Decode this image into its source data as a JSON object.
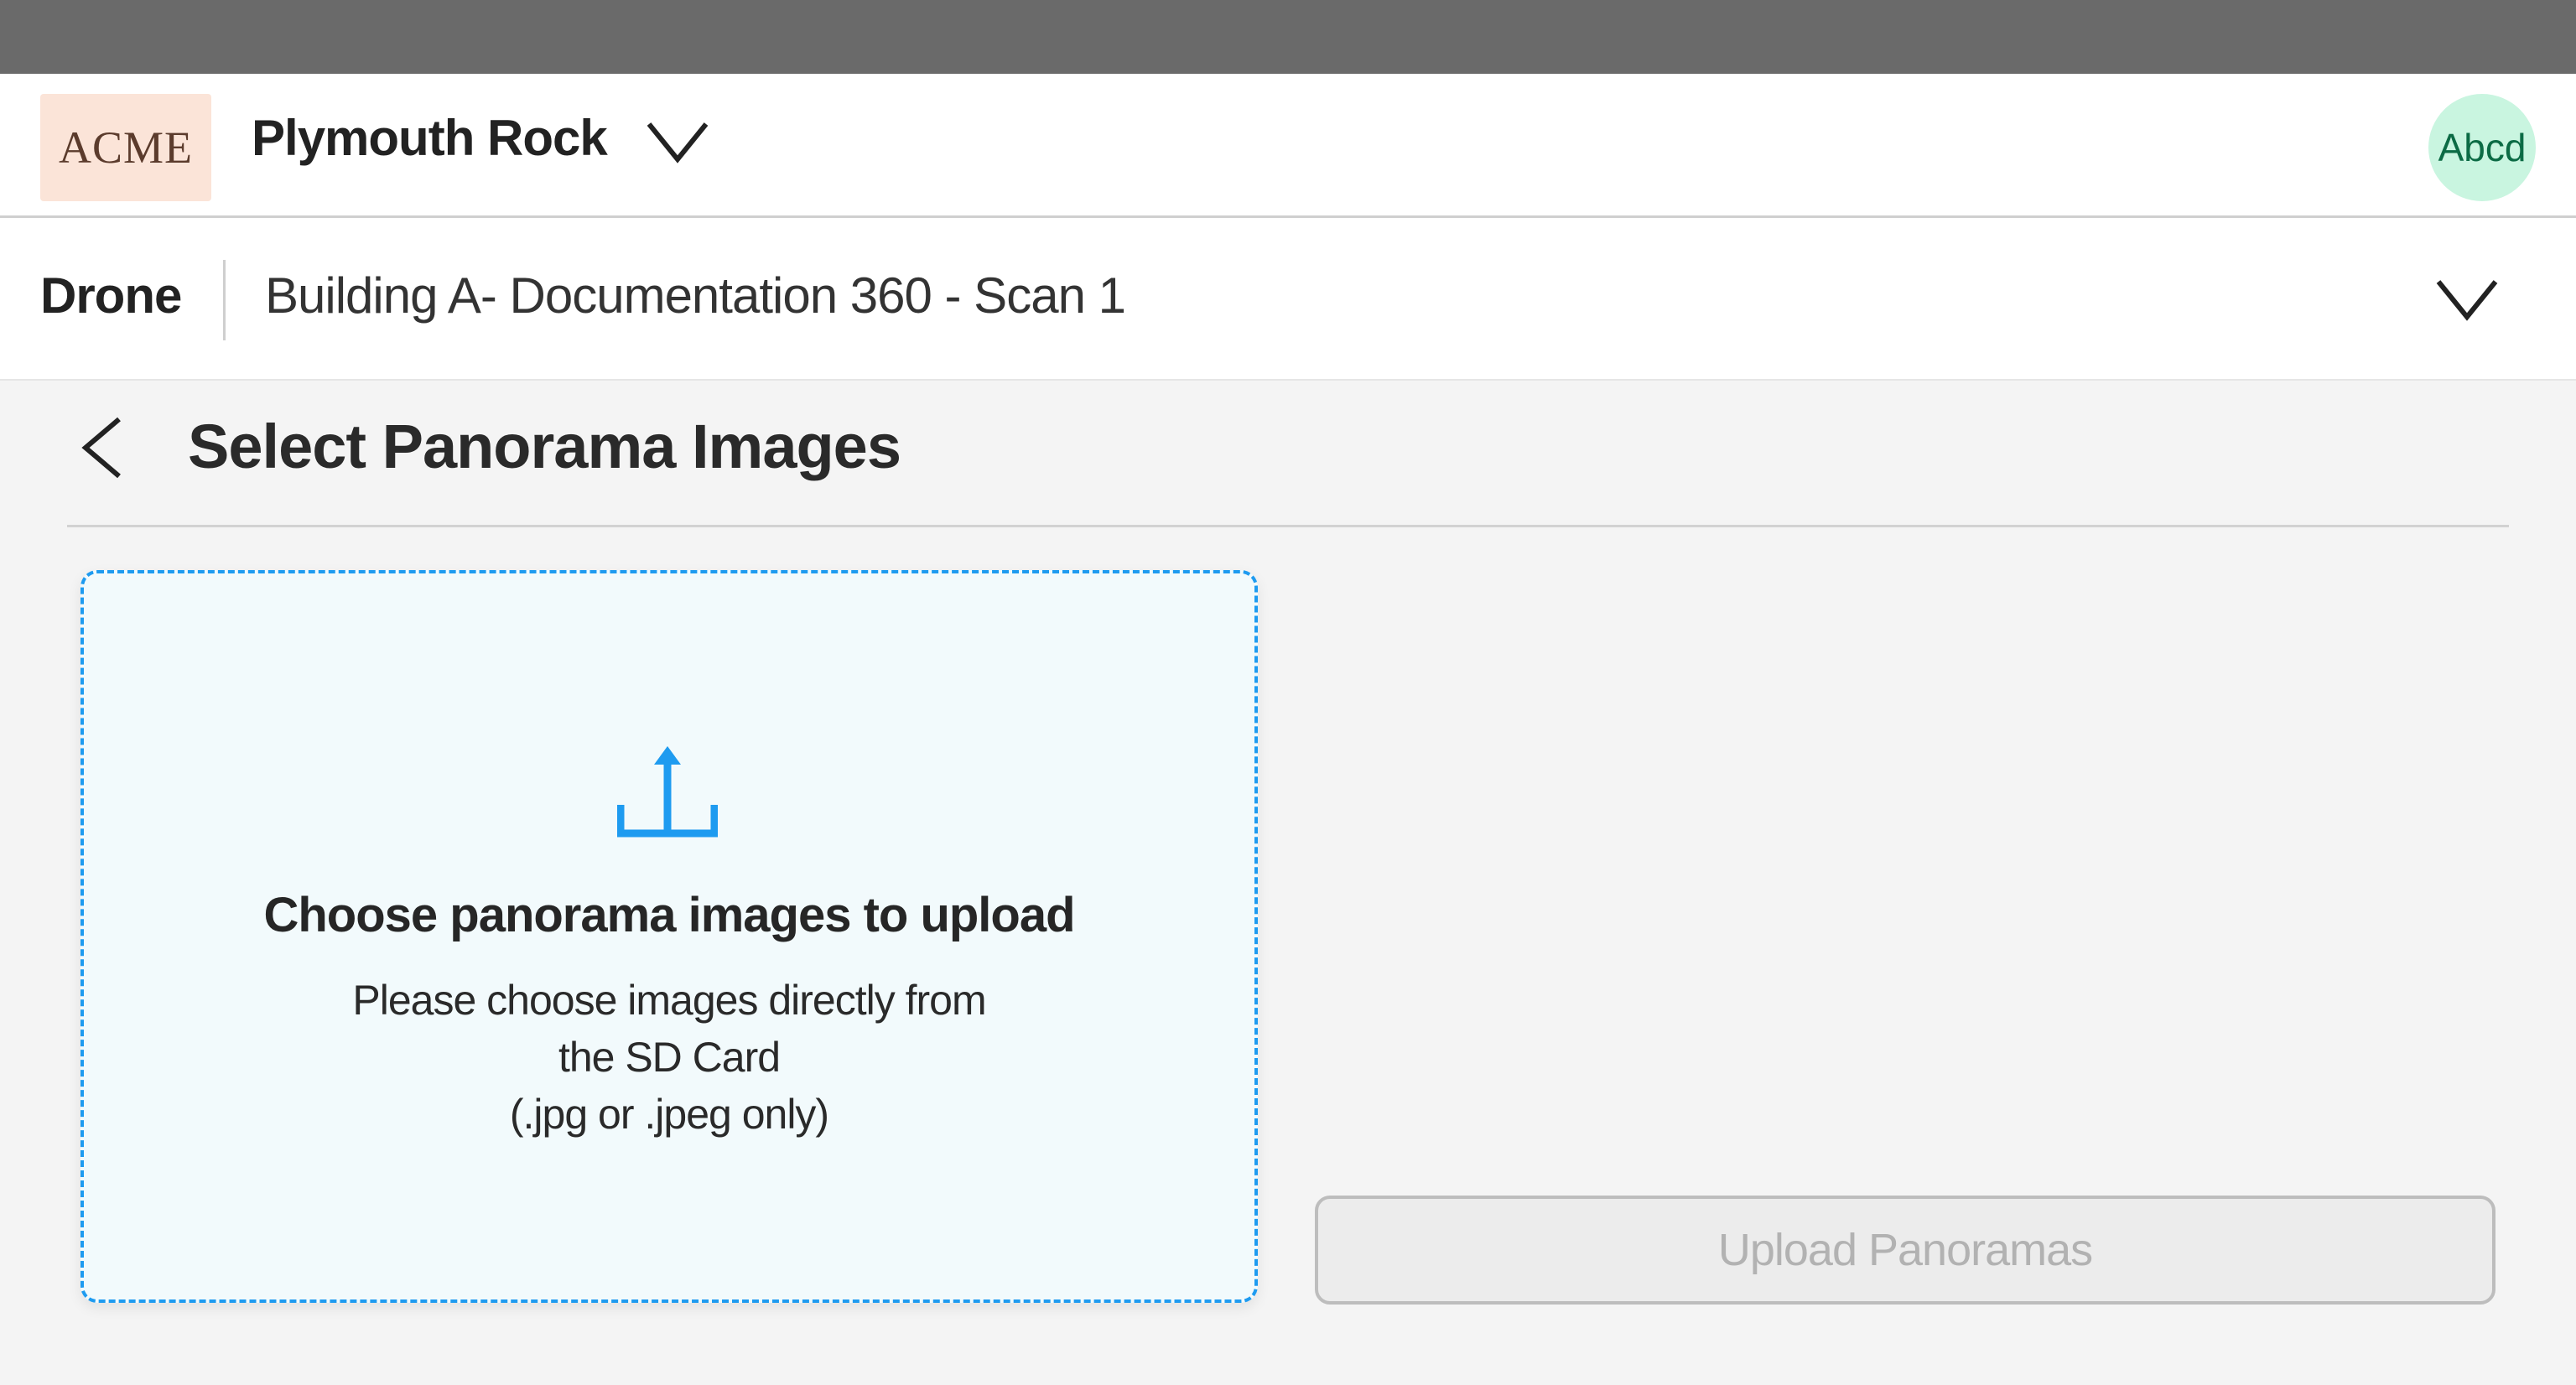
{
  "header": {
    "logo_text": "ACME",
    "org_name": "Plymouth Rock",
    "avatar_text": "Abcd"
  },
  "subheader": {
    "category": "Drone",
    "scan_title": "Building A- Documentation 360 -  Scan 1"
  },
  "page": {
    "title": "Select Panorama Images"
  },
  "dropzone": {
    "heading": "Choose panorama images to upload",
    "line1": "Please choose images directly from",
    "line2": "the SD Card",
    "line3": "(.jpg or .jpeg only)"
  },
  "actions": {
    "upload_label": "Upload Panoramas",
    "upload_enabled": false
  },
  "icons": {
    "org_dropdown": "chevron-down-icon",
    "scan_dropdown": "chevron-down-icon",
    "back": "chevron-left-icon",
    "upload": "upload-icon"
  },
  "colors": {
    "accent": "#1e9bf0",
    "avatar_bg": "#c9f5e0",
    "logo_bg": "#fbe4d8",
    "status_bar": "#6a6a6a"
  }
}
